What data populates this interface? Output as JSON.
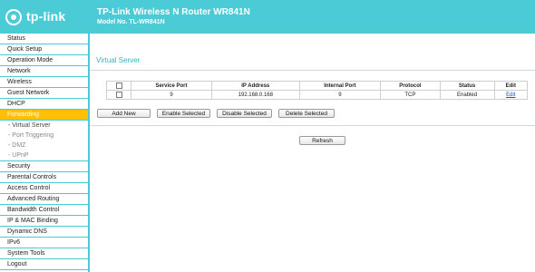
{
  "header": {
    "logo_text": "tp-link",
    "title": "TP-Link Wireless N Router WR841N",
    "model": "Model No. TL-WR841N",
    "accent_color": "#4acbd6"
  },
  "sidebar": {
    "items": [
      {
        "label": "Status"
      },
      {
        "label": "Quick Setup"
      },
      {
        "label": "Operation Mode"
      },
      {
        "label": "Network"
      },
      {
        "label": "Wireless"
      },
      {
        "label": "Guest Network"
      },
      {
        "label": "DHCP"
      },
      {
        "label": "Forwarding"
      },
      {
        "label": "- Virtual Server"
      },
      {
        "label": "- Port Triggering"
      },
      {
        "label": "- DMZ"
      },
      {
        "label": "- UPnP"
      },
      {
        "label": "Security"
      },
      {
        "label": "Parental Controls"
      },
      {
        "label": "Access Control"
      },
      {
        "label": "Advanced Routing"
      },
      {
        "label": "Bandwidth Control"
      },
      {
        "label": "IP & MAC Binding"
      },
      {
        "label": "Dynamic DNS"
      },
      {
        "label": "IPv6"
      },
      {
        "label": "System Tools"
      },
      {
        "label": "Logout"
      }
    ],
    "active_color": "#ffc000"
  },
  "main": {
    "section_title": "Virtual Server",
    "table": {
      "headers": [
        "Service Port",
        "IP Address",
        "Internal Port",
        "Protocol",
        "Status",
        "Edit"
      ],
      "rows": [
        {
          "service_port": "9",
          "ip_address": "192.168.0.168",
          "internal_port": "9",
          "protocol": "TCP",
          "status": "Enabled",
          "edit": "Edit"
        }
      ]
    },
    "buttons": {
      "add_new": "Add New",
      "enable_selected": "Enable Selected",
      "disable_selected": "Disable Selected",
      "delete_selected": "Delete Selected",
      "refresh": "Refresh"
    }
  }
}
